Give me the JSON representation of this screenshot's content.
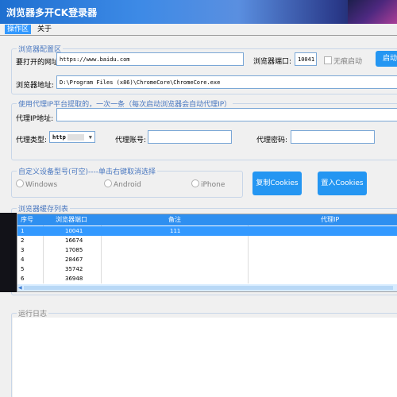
{
  "window": {
    "title": "浏览器多开CK登录器"
  },
  "tabs": [
    "操作区",
    "关于"
  ],
  "config": {
    "legend": "浏览器配置区",
    "url_label": "要打开的网址:",
    "url_value": "https://www.baidu.com",
    "port_label": "浏览器端口:",
    "port_value": "10041",
    "headless_label": "无痕启动",
    "start_button": "启动",
    "path_label": "浏览器地址:",
    "path_value": "D:\\Program Files (x86)\\ChromeCore\\ChromeCore.exe"
  },
  "proxy": {
    "legend": "使用代理IP平台提取的，一次一条（每次启动浏览器会自动代理IP）",
    "addr_label": "代理IP地址:",
    "type_label": "代理类型:",
    "type_value": "http",
    "account_label": "代理账号:",
    "password_label": "代理密码:"
  },
  "device": {
    "legend": "自定义设备型号(可空)----单击右键取消选择",
    "options": [
      "Windows",
      "Android",
      "iPhone"
    ],
    "copy_cookies_button": "复制Cookies",
    "import_cookies_button": "置入Cookies"
  },
  "cache": {
    "legend": "浏览器缓存列表",
    "columns": [
      "序号",
      "浏览器端口",
      "备注",
      "代理IP"
    ],
    "rows": [
      {
        "idx": "1",
        "port": "10041",
        "note": "111",
        "proxy": ""
      },
      {
        "idx": "2",
        "port": "16674",
        "note": "",
        "proxy": ""
      },
      {
        "idx": "3",
        "port": "17085",
        "note": "",
        "proxy": ""
      },
      {
        "idx": "4",
        "port": "28467",
        "note": "",
        "proxy": ""
      },
      {
        "idx": "5",
        "port": "35742",
        "note": "",
        "proxy": ""
      },
      {
        "idx": "6",
        "port": "36948",
        "note": "",
        "proxy": ""
      }
    ]
  },
  "log": {
    "legend": "运行日志"
  },
  "colors": {
    "accent": "#2496f2",
    "header": "#2e8ff0",
    "selected_row": "#3399ff"
  }
}
